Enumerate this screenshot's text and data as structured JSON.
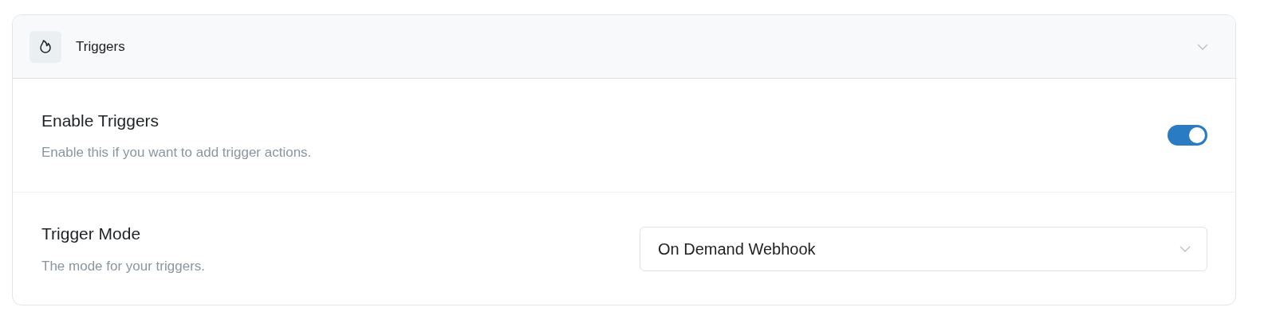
{
  "section": {
    "title": "Triggers",
    "expanded": true
  },
  "settings": [
    {
      "kind": "toggle",
      "label": "Enable Triggers",
      "description": "Enable this if you want to add trigger actions.",
      "on": true
    },
    {
      "kind": "select",
      "label": "Trigger Mode",
      "description": "The mode for your triggers.",
      "value": "On Demand Webhook"
    }
  ]
}
